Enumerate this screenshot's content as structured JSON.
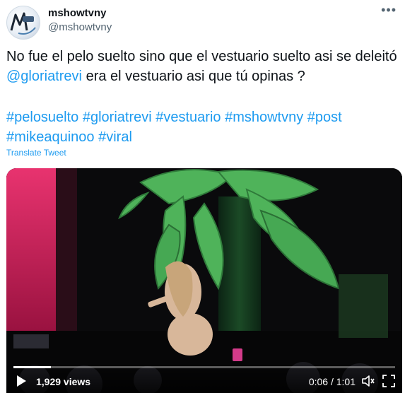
{
  "author": {
    "display_name": "mshowtvny",
    "handle": "@mshowtvny",
    "avatar_label": "MShowTV"
  },
  "tweet": {
    "text_part1": "No fue el pelo suelto sino que el vestuario suelto asi se deleitó ",
    "mention": "@gloriatrevi",
    "text_part2": " era el vestuario asi que tú opinas ?",
    "hashtags_line1": "#pelosuelto #gloriatrevi #vestuario #mshowtvny #post",
    "hashtags_line2": "#mikeaquinoo #viral",
    "translate_label": "Translate Tweet"
  },
  "video": {
    "views": "1,929 views",
    "time": "0:06 / 1:01",
    "progress_fraction": 0.098
  },
  "icons": {
    "more": "more-options-icon",
    "play": "play-icon",
    "volume": "volume-icon",
    "fullscreen": "fullscreen-icon"
  },
  "colors": {
    "accent": "#1d9bf0",
    "text": "#0f1419",
    "secondary": "#536471"
  }
}
